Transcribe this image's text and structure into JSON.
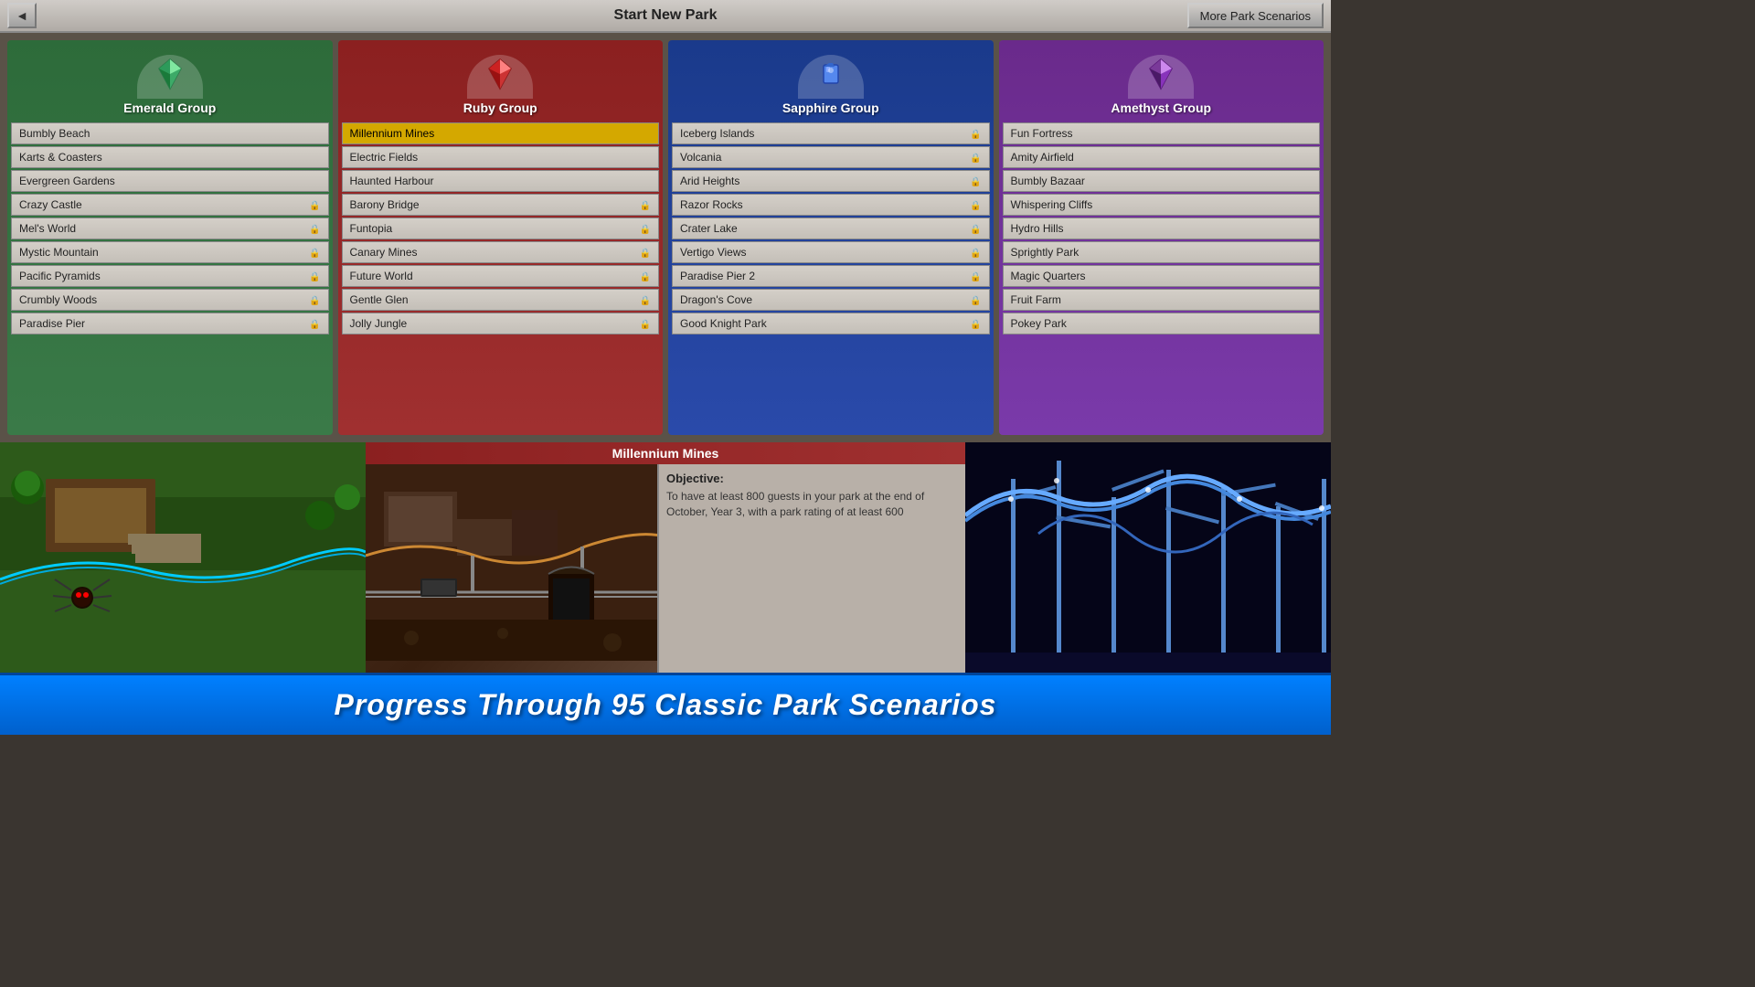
{
  "header": {
    "title": "Start New Park",
    "back_label": "◄",
    "more_scenarios_label": "More Park Scenarios"
  },
  "groups": [
    {
      "id": "emerald",
      "name": "Emerald Group",
      "gem_color": "#2ecc71",
      "scenarios": [
        {
          "name": "Bumbly Beach",
          "locked": false
        },
        {
          "name": "Karts & Coasters",
          "locked": false
        },
        {
          "name": "Evergreen Gardens",
          "locked": false
        },
        {
          "name": "Crazy Castle",
          "locked": true
        },
        {
          "name": "Mel's World",
          "locked": true
        },
        {
          "name": "Mystic Mountain",
          "locked": true
        },
        {
          "name": "Pacific Pyramids",
          "locked": true
        },
        {
          "name": "Crumbly Woods",
          "locked": true
        },
        {
          "name": "Paradise Pier",
          "locked": true
        }
      ]
    },
    {
      "id": "ruby",
      "name": "Ruby Group",
      "gem_color": "#e74c3c",
      "scenarios": [
        {
          "name": "Millennium Mines",
          "locked": false,
          "selected": true
        },
        {
          "name": "Electric Fields",
          "locked": false
        },
        {
          "name": "Haunted Harbour",
          "locked": false
        },
        {
          "name": "Barony Bridge",
          "locked": true
        },
        {
          "name": "Funtopia",
          "locked": true
        },
        {
          "name": "Canary Mines",
          "locked": true
        },
        {
          "name": "Future World",
          "locked": true
        },
        {
          "name": "Gentle Glen",
          "locked": true
        },
        {
          "name": "Jolly Jungle",
          "locked": true
        }
      ]
    },
    {
      "id": "sapphire",
      "name": "Sapphire Group",
      "gem_color": "#3498db",
      "scenarios": [
        {
          "name": "Iceberg Islands",
          "locked": true
        },
        {
          "name": "Volcania",
          "locked": true
        },
        {
          "name": "Arid Heights",
          "locked": true
        },
        {
          "name": "Razor Rocks",
          "locked": true
        },
        {
          "name": "Crater Lake",
          "locked": true
        },
        {
          "name": "Vertigo Views",
          "locked": true
        },
        {
          "name": "Paradise Pier 2",
          "locked": true
        },
        {
          "name": "Dragon's Cove",
          "locked": true
        },
        {
          "name": "Good Knight Park",
          "locked": true
        }
      ]
    },
    {
      "id": "amethyst",
      "name": "Amethyst Group",
      "gem_color": "#9b59b6",
      "scenarios": [
        {
          "name": "Fun Fortress",
          "locked": false
        },
        {
          "name": "Amity Airfield",
          "locked": false
        },
        {
          "name": "Bumbly Bazaar",
          "locked": false
        },
        {
          "name": "Whispering Cliffs",
          "locked": false
        },
        {
          "name": "Hydro Hills",
          "locked": false
        },
        {
          "name": "Sprightly Park",
          "locked": false
        },
        {
          "name": "Magic Quarters",
          "locked": false
        },
        {
          "name": "Fruit Farm",
          "locked": false
        },
        {
          "name": "Pokey Park",
          "locked": false
        }
      ]
    }
  ],
  "preview": {
    "selected_scenario": "Millennium Mines",
    "objective_label": "Objective:",
    "objective_text": "To have at least 800 guests in your park at the end of October, Year 3, with a park rating of at least 600"
  },
  "banner": {
    "text": "Progress Through 95 Classic Park Scenarios"
  }
}
